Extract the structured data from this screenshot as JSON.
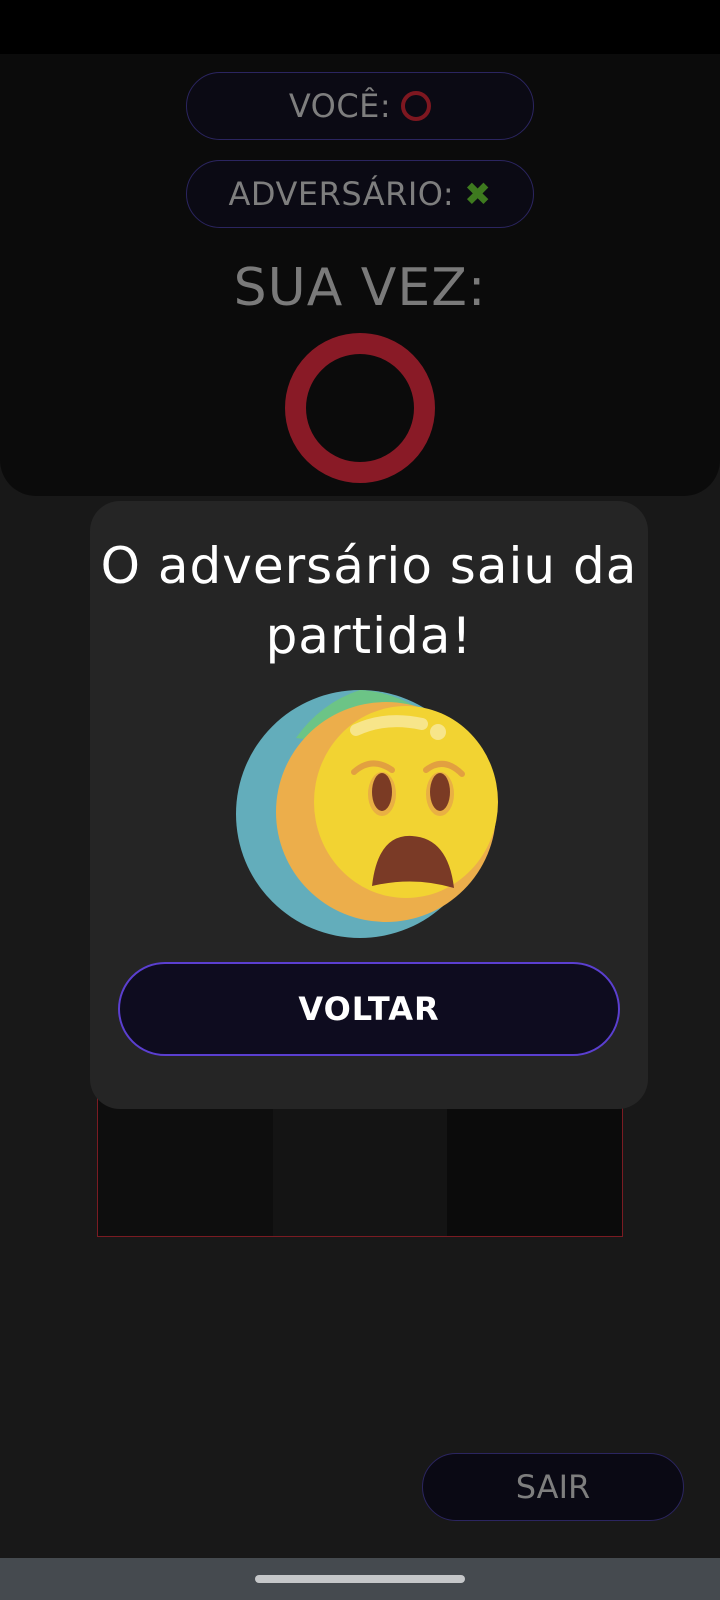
{
  "players": {
    "you_label": "VOCÊ:",
    "you_symbol_icon": "circle-o-icon",
    "opponent_label": "ADVERSÁRIO:",
    "opponent_symbol_icon": "x-mark-icon",
    "opponent_symbol_glyph": "✖"
  },
  "turn": {
    "label": "SUA VEZ:",
    "symbol_icon": "circle-o-icon"
  },
  "modal": {
    "title": "O adversário saiu da partida!",
    "emoji_icon": "frightened-face-icon",
    "back_button_label": "VOLTAR"
  },
  "footer": {
    "exit_button_label": "SAIR"
  },
  "colors": {
    "o_color": "#891a26",
    "x_color": "#3e7a1f",
    "button_border": "#5b3fd0",
    "pill_border": "#2b2560"
  }
}
